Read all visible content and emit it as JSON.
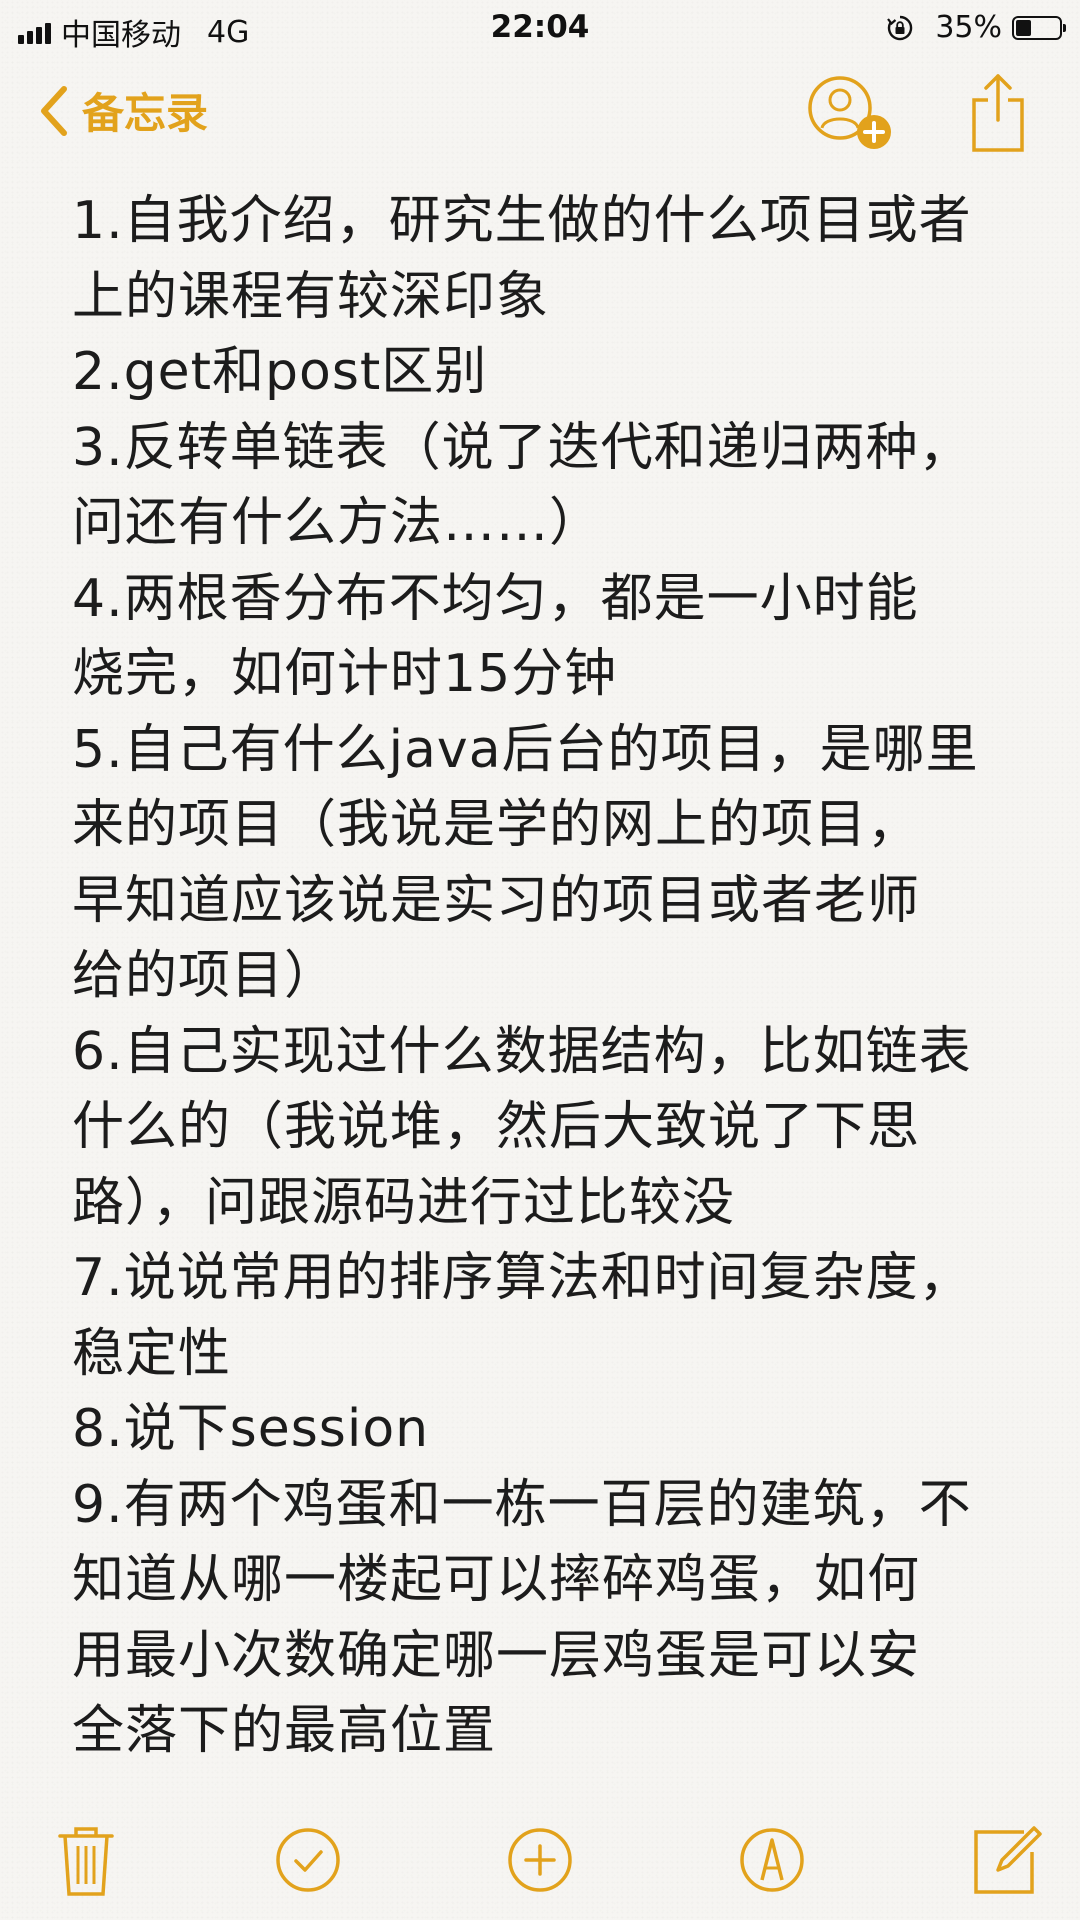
{
  "status_bar": {
    "carrier": "中国移动",
    "network": "4G",
    "time": "22:04",
    "battery_percent_label": "35%",
    "battery_level": 0.35
  },
  "nav": {
    "back_label": "备忘录",
    "back_icon": "chevron-left-icon",
    "add_person_icon": "add-person-icon",
    "share_icon": "share-icon"
  },
  "colors": {
    "accent": "#e2a21c",
    "background": "#f6f5f2",
    "text": "#1c1c1c"
  },
  "note": {
    "lines": [
      "1.自我介绍，研究生做的什么项目或者",
      "上的课程有较深印象",
      "2.get和post区别",
      "3.反转单链表（说了迭代和递归两种，",
      "问还有什么方法……）",
      "4.两根香分布不均匀，都是一小时能",
      "烧完，如何计时15分钟",
      "5.自己有什么java后台的项目，是哪里",
      "来的项目（我说是学的网上的项目，",
      "早知道应该说是实习的项目或者老师",
      "给的项目）",
      "6.自己实现过什么数据结构，比如链表",
      "什么的（我说堆，然后大致说了下思",
      "路），问跟源码进行过比较没",
      "7.说说常用的排序算法和时间复杂度，",
      "稳定性",
      "8.说下session",
      "9.有两个鸡蛋和一栋一百层的建筑，不",
      "知道从哪一楼起可以摔碎鸡蛋，如何",
      "用最小次数确定哪一层鸡蛋是可以安",
      "全落下的最高位置"
    ]
  },
  "toolbar": {
    "items": [
      "trash-icon",
      "checklist-icon",
      "add-icon",
      "markup-icon",
      "compose-icon"
    ]
  }
}
